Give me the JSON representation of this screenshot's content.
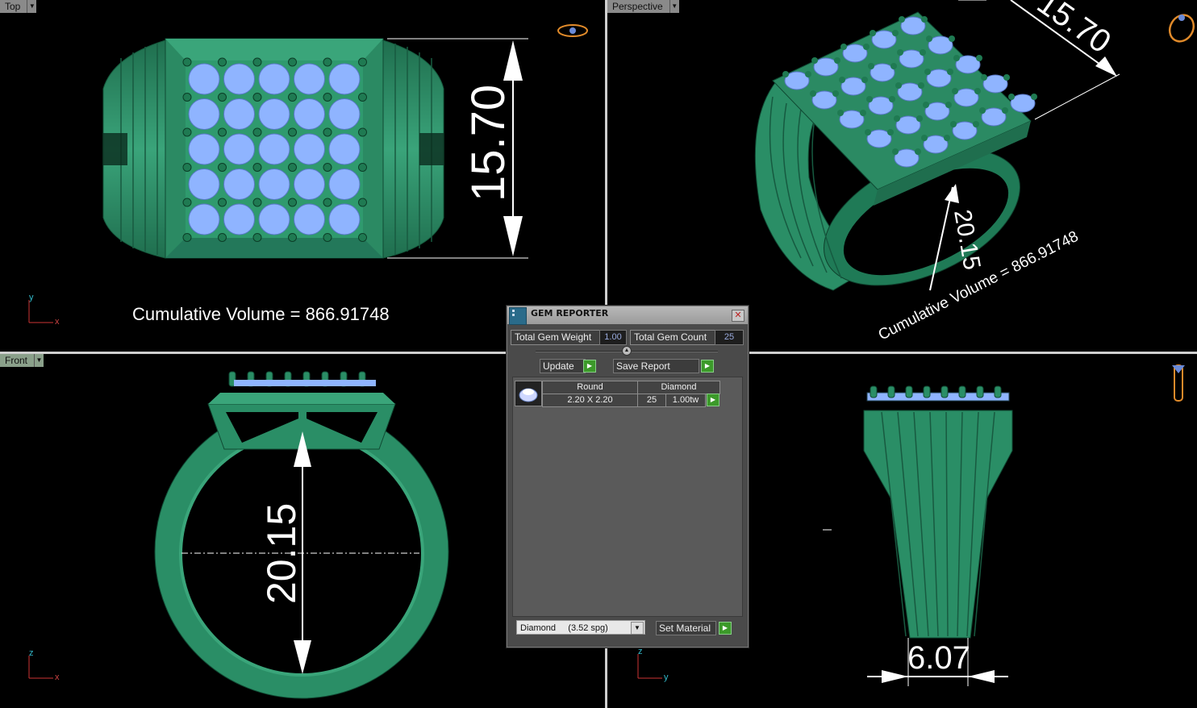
{
  "viewports": {
    "top": {
      "label": "Top",
      "volume_text": "Cumulative Volume = 866.91748",
      "dimension": "15.70",
      "axis_y": "y",
      "axis_x": "x"
    },
    "perspective": {
      "label": "Perspective",
      "dimension_top": "15.70",
      "dimension_ring": "20.15",
      "volume_text": "Cumulative Volume = 866.91748"
    },
    "front": {
      "label": "Front",
      "dimension": "20.15",
      "axis_y": "z",
      "axis_x": "x"
    },
    "right": {
      "dimension": "6.07",
      "axis_y": "z",
      "axis_x": "y"
    }
  },
  "gem_reporter": {
    "title": "GEM REPORTER",
    "total_weight_label": "Total Gem Weight",
    "total_weight_value": "1.00",
    "total_count_label": "Total Gem Count",
    "total_count_value": "25",
    "update_label": "Update",
    "save_report_label": "Save Report",
    "rows": [
      {
        "shape": "Round",
        "material": "Diamond",
        "size": "2.20 X 2.20",
        "count": "25",
        "weight": "1.00tw"
      }
    ],
    "material_select": "Diamond     (3.52 spg)",
    "set_material_label": "Set Material"
  },
  "colors": {
    "ring_green": "#2f9a6e",
    "gem_blue": "#8fb4ff",
    "dimension": "#ffffff"
  },
  "icons": [
    "close-icon",
    "gem-icon",
    "play-icon",
    "dropdown-arrow-icon",
    "ring-view-icon"
  ]
}
